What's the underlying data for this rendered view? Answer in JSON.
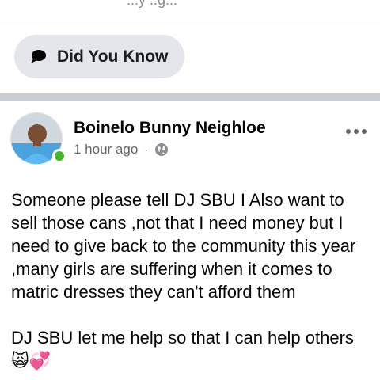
{
  "top_strip": {
    "text": "...y ..g..."
  },
  "chip": {
    "label": "Did You Know",
    "icon": "speech-bubble-icon"
  },
  "post": {
    "author": "Boinelo Bunny Neighloe",
    "time": "1 hour ago",
    "separator": "·",
    "privacy_icon": "globe-icon",
    "more_icon": "more-options-icon",
    "presence": "online",
    "body": "Someone please tell DJ SBU I Also want to sell those cans ,not that I need money but I need to give back to the community this year ,many girls are suffering when it comes to matric dresses they can't afford them\n\nDJ SBU let me help so that I can help others🙀💞"
  },
  "colors": {
    "chip_bg": "#e4e6eb",
    "separator": "#c9ccd1",
    "online": "#42b72a",
    "meta": "#65676b"
  }
}
